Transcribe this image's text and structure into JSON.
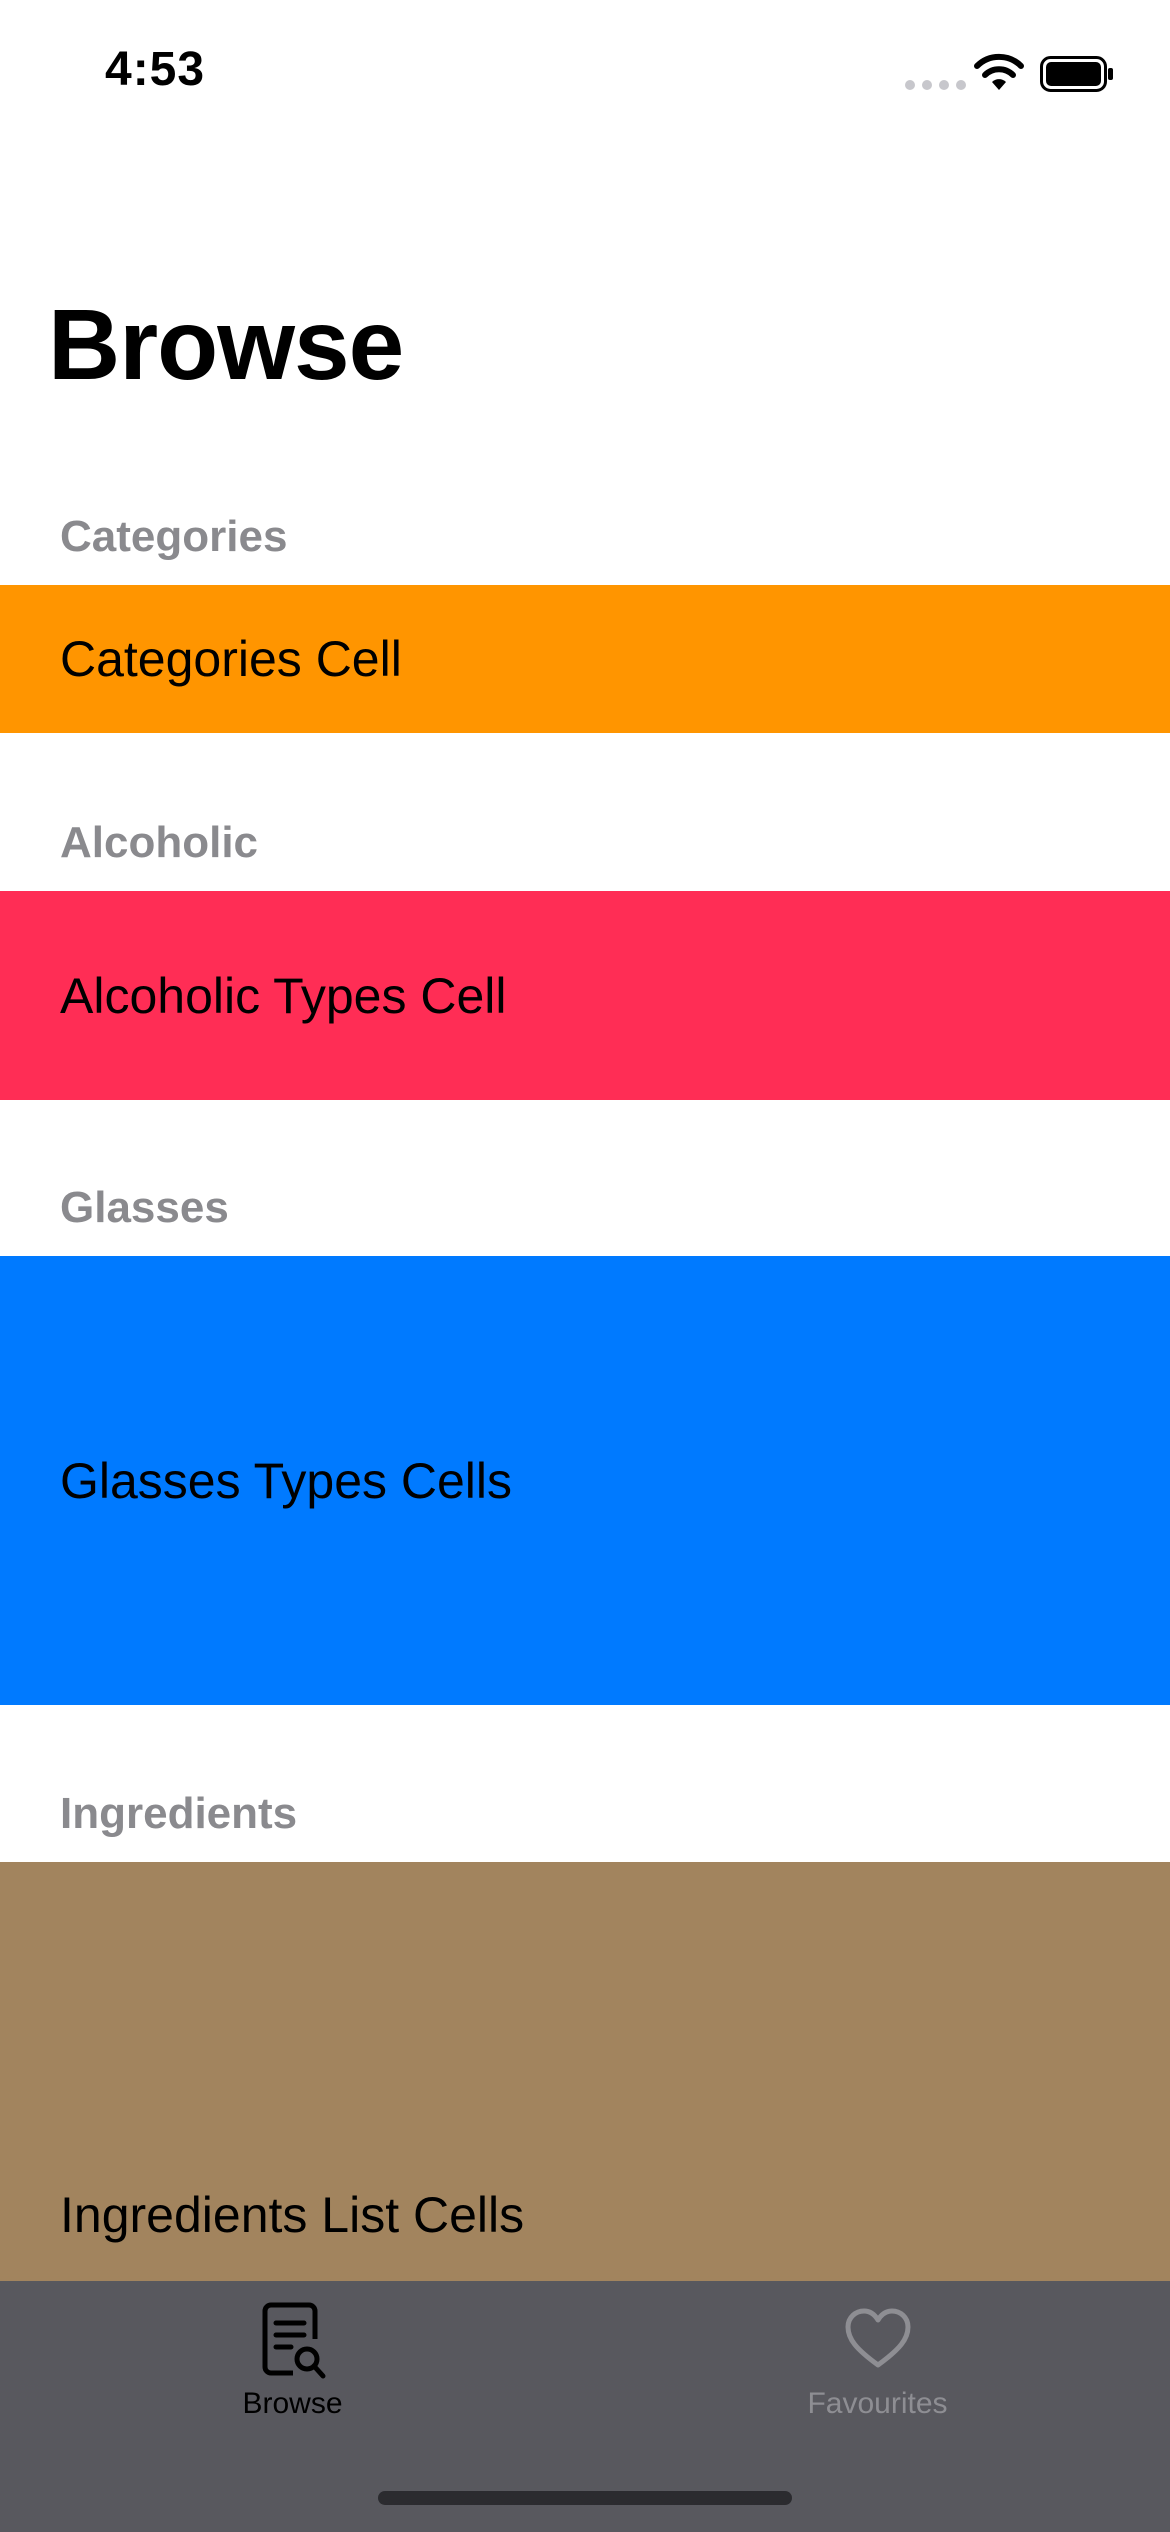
{
  "status_bar": {
    "time": "4:53"
  },
  "title": "Browse",
  "sections": [
    {
      "header": "Categories",
      "cell": "Categories Cell",
      "color": "#FF9500"
    },
    {
      "header": "Alcoholic",
      "cell": "Alcoholic Types Cell",
      "color": "#FF2D55"
    },
    {
      "header": "Glasses",
      "cell": "Glasses Types Cells",
      "color": "#007AFF"
    },
    {
      "header": "Ingredients",
      "cell": "Ingredients List Cells",
      "color": "#A2845E"
    }
  ],
  "tab_bar": {
    "background": "#58585E",
    "tabs": [
      {
        "label": "Browse",
        "icon": "document-search-icon",
        "selected": true
      },
      {
        "label": "Favourites",
        "icon": "heart-icon",
        "selected": false
      }
    ]
  }
}
